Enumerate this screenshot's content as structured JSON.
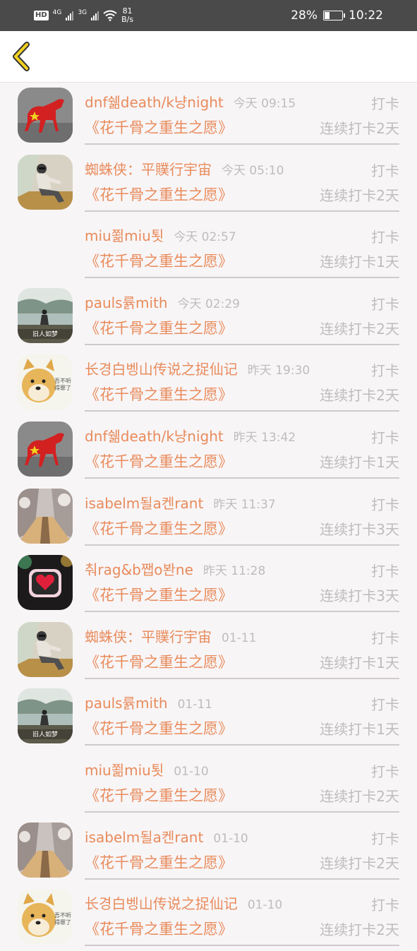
{
  "status_bar": {
    "hd_label": "HD",
    "net1": "4G",
    "net2": "3G",
    "speed_value": "81",
    "speed_unit": "B/s",
    "battery": "28%",
    "battery_level": 0.28,
    "time": "10:22"
  },
  "header": {
    "back_icon": "chevron-left-icon",
    "accent_color": "#f2d21f"
  },
  "items": [
    {
      "name": "dnf쉚death/k냥night",
      "time": "今天 09:15",
      "action": "打卡",
      "book": "《花千骨之重生之愿》",
      "streak": "连续打卡2天",
      "avatar": "red-horse"
    },
    {
      "name": "蜘蛛侠：平贌行宇宙",
      "time": "今天 05:10",
      "action": "打卡",
      "book": "《花千骨之重生之愿》",
      "streak": "连续打卡2天",
      "avatar": "man-sitting"
    },
    {
      "name": "miu쬚miu툇",
      "time": "今天 02:57",
      "action": "打卡",
      "book": "《花千骨之重生之愿》",
      "streak": "连续打卡1天",
      "avatar": "none"
    },
    {
      "name": "pauls륡mith",
      "time": "今天 02:29",
      "action": "打卡",
      "book": "《花千骨之重生之愿》",
      "streak": "连续打卡2天",
      "avatar": "lake-girl"
    },
    {
      "name": "长경白벵山传说之捉仙记",
      "time": "昨天 19:30",
      "action": "打卡",
      "book": "《花千骨之重生之愿》",
      "streak": "连续打卡2天",
      "avatar": "doge"
    },
    {
      "name": "dnf쉚death/k냥night",
      "time": "昨天 13:42",
      "action": "打卡",
      "book": "《花千骨之重生之愿》",
      "streak": "连续打卡1天",
      "avatar": "red-horse"
    },
    {
      "name": "isabelm될a켄rant",
      "time": "昨天 11:37",
      "action": "打卡",
      "book": "《花千骨之重生之愿》",
      "streak": "连续打卡3天",
      "avatar": "snow-road"
    },
    {
      "name": "춰rag&b쨉o봔ne",
      "time": "昨天 11:28",
      "action": "打卡",
      "book": "《花千骨之重生之愿》",
      "streak": "连续打卡3天",
      "avatar": "heart"
    },
    {
      "name": "蜘蛛侠：平贌行宇宙",
      "time": "01-11",
      "action": "打卡",
      "book": "《花千骨之重生之愿》",
      "streak": "连续打卡1天",
      "avatar": "man-sitting"
    },
    {
      "name": "pauls륡mith",
      "time": "01-11",
      "action": "打卡",
      "book": "《花千骨之重生之愿》",
      "streak": "连续打卡1天",
      "avatar": "lake-girl"
    },
    {
      "name": "miu쬚miu툇",
      "time": "01-10",
      "action": "打卡",
      "book": "《花千骨之重生之愿》",
      "streak": "连续打卡2天",
      "avatar": "none"
    },
    {
      "name": "isabelm될a켄rant",
      "time": "01-10",
      "action": "打卡",
      "book": "《花千骨之重生之愿》",
      "streak": "连续打卡2天",
      "avatar": "snow-road"
    },
    {
      "name": "长경白벵山传说之捉仙记",
      "time": "01-10",
      "action": "打卡",
      "book": "《花千骨之重生之愿》",
      "streak": "连续打卡2天",
      "avatar": "doge"
    }
  ],
  "avatar_text": {
    "lake_caption": "旧人如梦",
    "doge_caption": "吾不听 得罪了"
  }
}
